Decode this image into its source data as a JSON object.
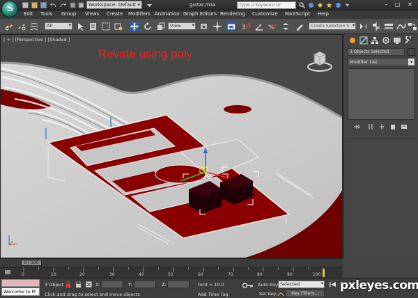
{
  "titlebar": {
    "workspace": "Workspace: Default",
    "file_name": "guitar.max",
    "search_placeholder": "Type a keyword or phrase"
  },
  "menu": {
    "items": [
      "Edit",
      "Tools",
      "Group",
      "Views",
      "Create",
      "Modifiers",
      "Animation",
      "Graph Editors",
      "Rendering",
      "Customize",
      "MAXScript",
      "Help"
    ]
  },
  "toolbar": {
    "selection_filter": "All",
    "reference_coord": "View",
    "named_selection_set": "Create Selection S"
  },
  "viewport": {
    "label": "[ + ] [Perspective ] [Shaded ]",
    "annotation": "Revate using poly",
    "annotation_color": "#e22222"
  },
  "command_panel": {
    "object_name": "3 Objects Selected",
    "modifier_list": "Modifier List"
  },
  "timeline": {
    "frame_indicator": "0 / 100",
    "ticks": [
      "0",
      "10",
      "20",
      "30",
      "40",
      "50",
      "60",
      "70",
      "80",
      "90",
      "100"
    ]
  },
  "status": {
    "maxscript_text": "Welcome to M",
    "selection_count": "3 Object",
    "x_label": "X:",
    "y_label": "Y:",
    "z_label": "Z:",
    "grid": "Grid = 10.0",
    "hint": "Click and drag to select and move objects",
    "add_time_tag": "Add Time Tag",
    "auto_key": "Auto Key",
    "set_key": "Set Key",
    "key_mode": "Selected",
    "key_filters": "Key Filters..."
  },
  "watermark": "pxleyes.com"
}
